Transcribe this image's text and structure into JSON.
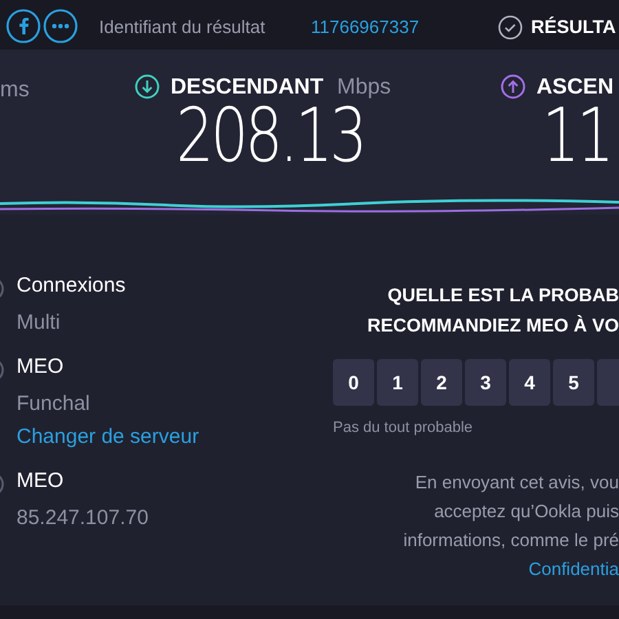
{
  "top_bar": {
    "result_id_label": "Identifiant du résultat",
    "result_id": "11766967337",
    "results_label": "RÉSULTA"
  },
  "metrics": [
    {
      "kind": "ping",
      "unit": "ms"
    },
    {
      "kind": "download",
      "label": "DESCENDANT",
      "unit": "Mbps",
      "value": "208.13"
    },
    {
      "kind": "upload",
      "label": "ASCEN",
      "value": "11"
    }
  ],
  "details": [
    {
      "title": "Connexions",
      "value": "Multi"
    },
    {
      "title": "MEO",
      "value": "Funchal",
      "link": "Changer de serveur"
    },
    {
      "title": "MEO",
      "value": "85.247.107.70"
    }
  ],
  "survey": {
    "question": [
      "QUELLE EST LA PROBAB",
      "RECOMMANDIEZ MEO À VO"
    ],
    "scores": [
      "0",
      "1",
      "2",
      "3",
      "4",
      "5"
    ],
    "low_label": "Pas du tout probable",
    "notice": [
      "En envoyant cet avis, vou",
      "acceptez qu’Ookla puis",
      "informations, comme le pré"
    ],
    "link": "Confidentia"
  }
}
